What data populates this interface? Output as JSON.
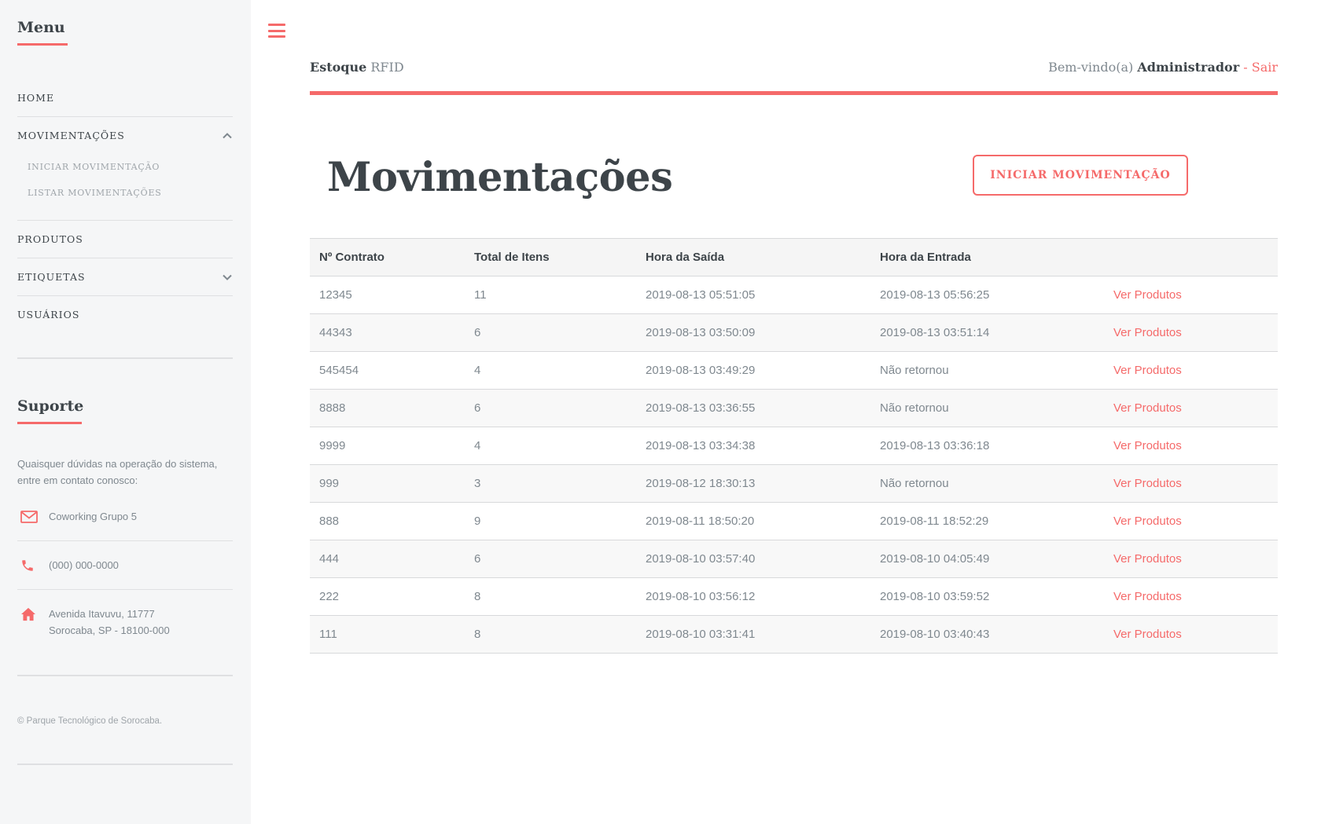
{
  "sidebar": {
    "menu_title": "Menu",
    "items": [
      {
        "label": "Home"
      },
      {
        "label": "Movimentações",
        "expanded": true,
        "icon": "chevron-up-icon",
        "children": [
          {
            "label": "Iniciar Movimentação"
          },
          {
            "label": "Listar Movimentações"
          }
        ]
      },
      {
        "label": "Produtos"
      },
      {
        "label": "Etiquetas",
        "expanded": false,
        "icon": "chevron-down-icon"
      },
      {
        "label": "Usuários"
      }
    ],
    "support_title": "Suporte",
    "support_text": "Quaisquer dúvidas na operação do sistema, entre em contato conosco:",
    "contacts": {
      "email": {
        "icon": "envelope-icon",
        "text": "Coworking Grupo 5"
      },
      "phone": {
        "icon": "phone-icon",
        "text": "(000) 000-0000"
      },
      "address": {
        "icon": "home-icon",
        "line1": "Avenida Itavuvu, 11777",
        "line2": "Sorocaba, SP - 18100-000"
      }
    },
    "copyright": "© Parque Tecnológico de Sorocaba."
  },
  "header": {
    "logo_bold": "Estoque",
    "logo_light": "RFID",
    "welcome_prefix": "Bem-vindo(a)",
    "user": "Administrador",
    "logout": "- Sair"
  },
  "main": {
    "title": "Movimentações",
    "action_button": "Iniciar Movimentação",
    "table": {
      "columns": [
        "Nº Contrato",
        "Total de Itens",
        "Hora da Saída",
        "Hora da Entrada",
        ""
      ],
      "rows": [
        {
          "contrato": "12345",
          "itens": "11",
          "saida": "2019-08-13 05:51:05",
          "entrada": "2019-08-13 05:56:25",
          "link": "Ver Produtos"
        },
        {
          "contrato": "44343",
          "itens": "6",
          "saida": "2019-08-13 03:50:09",
          "entrada": "2019-08-13 03:51:14",
          "link": "Ver Produtos"
        },
        {
          "contrato": "545454",
          "itens": "4",
          "saida": "2019-08-13 03:49:29",
          "entrada": "Não retornou",
          "link": "Ver Produtos"
        },
        {
          "contrato": "8888",
          "itens": "6",
          "saida": "2019-08-13 03:36:55",
          "entrada": "Não retornou",
          "link": "Ver Produtos"
        },
        {
          "contrato": "9999",
          "itens": "4",
          "saida": "2019-08-13 03:34:38",
          "entrada": "2019-08-13 03:36:18",
          "link": "Ver Produtos"
        },
        {
          "contrato": "999",
          "itens": "3",
          "saida": "2019-08-12 18:30:13",
          "entrada": "Não retornou",
          "link": "Ver Produtos"
        },
        {
          "contrato": "888",
          "itens": "9",
          "saida": "2019-08-11 18:50:20",
          "entrada": "2019-08-11 18:52:29",
          "link": "Ver Produtos"
        },
        {
          "contrato": "444",
          "itens": "6",
          "saida": "2019-08-10 03:57:40",
          "entrada": "2019-08-10 04:05:49",
          "link": "Ver Produtos"
        },
        {
          "contrato": "222",
          "itens": "8",
          "saida": "2019-08-10 03:56:12",
          "entrada": "2019-08-10 03:59:52",
          "link": "Ver Produtos"
        },
        {
          "contrato": "111",
          "itens": "8",
          "saida": "2019-08-10 03:31:41",
          "entrada": "2019-08-10 03:40:43",
          "link": "Ver Produtos"
        }
      ]
    }
  },
  "colors": {
    "accent": "#f56a6a",
    "heading": "#3d4449",
    "text": "#7f888f",
    "sidebar_bg": "#f5f6f7"
  },
  "icons": {
    "menu_toggle": "hamburger-icon"
  }
}
